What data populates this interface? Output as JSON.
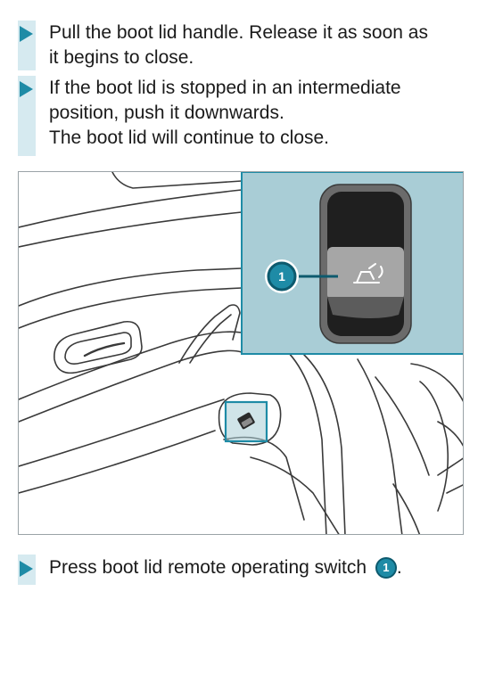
{
  "steps_top": [
    {
      "lines": [
        "Pull the boot lid handle. Release it as soon as",
        "it begins to close."
      ]
    },
    {
      "lines": [
        "If the boot lid is stopped in an intermediate",
        "position, push it downwards.",
        "The boot lid will continue to close."
      ]
    }
  ],
  "figure": {
    "callout_number": "1",
    "icon": "boot-lid-open-icon"
  },
  "step_bottom": {
    "text": "Press boot lid remote operating switch",
    "callout_number": "1",
    "suffix": "."
  },
  "colors": {
    "accent": "#1e8ba6",
    "bar": "#d6eaf0",
    "inset_bg": "#a9cdd6"
  }
}
